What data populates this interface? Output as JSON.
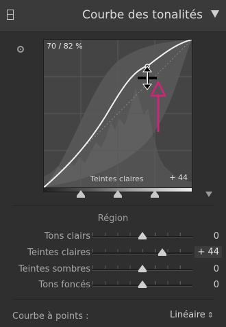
{
  "panel": {
    "title": "Courbe des tonalités",
    "collapse_icon": "triangle-down-icon",
    "panel_icon": "panel-switch-icon"
  },
  "curve": {
    "readout": "70 / 82 %",
    "region_label": "Teintes claires",
    "region_value": "+ 44",
    "target_tool_icon": "target-adjust-icon",
    "cursor_icon": "vertical-drag-cursor-icon",
    "annotation_icon": "pink-arrow-icon",
    "annotation_color": "#d6217a",
    "split_points": [
      0.25,
      0.5,
      0.75
    ]
  },
  "region": {
    "title": "Région",
    "sliders": [
      {
        "label": "Tons clairs",
        "value": "0",
        "position": 0.5,
        "active": false
      },
      {
        "label": "Teintes claires",
        "value": "+ 44",
        "position": 0.72,
        "active": true
      },
      {
        "label": "Teintes sombres",
        "value": "0",
        "position": 0.5,
        "active": false
      },
      {
        "label": "Tons foncés",
        "value": "0",
        "position": 0.5,
        "active": false
      }
    ]
  },
  "footer": {
    "label": "Courbe à points :",
    "select_value": "Linéaire",
    "select_icon": "up-down-chevron-icon"
  }
}
